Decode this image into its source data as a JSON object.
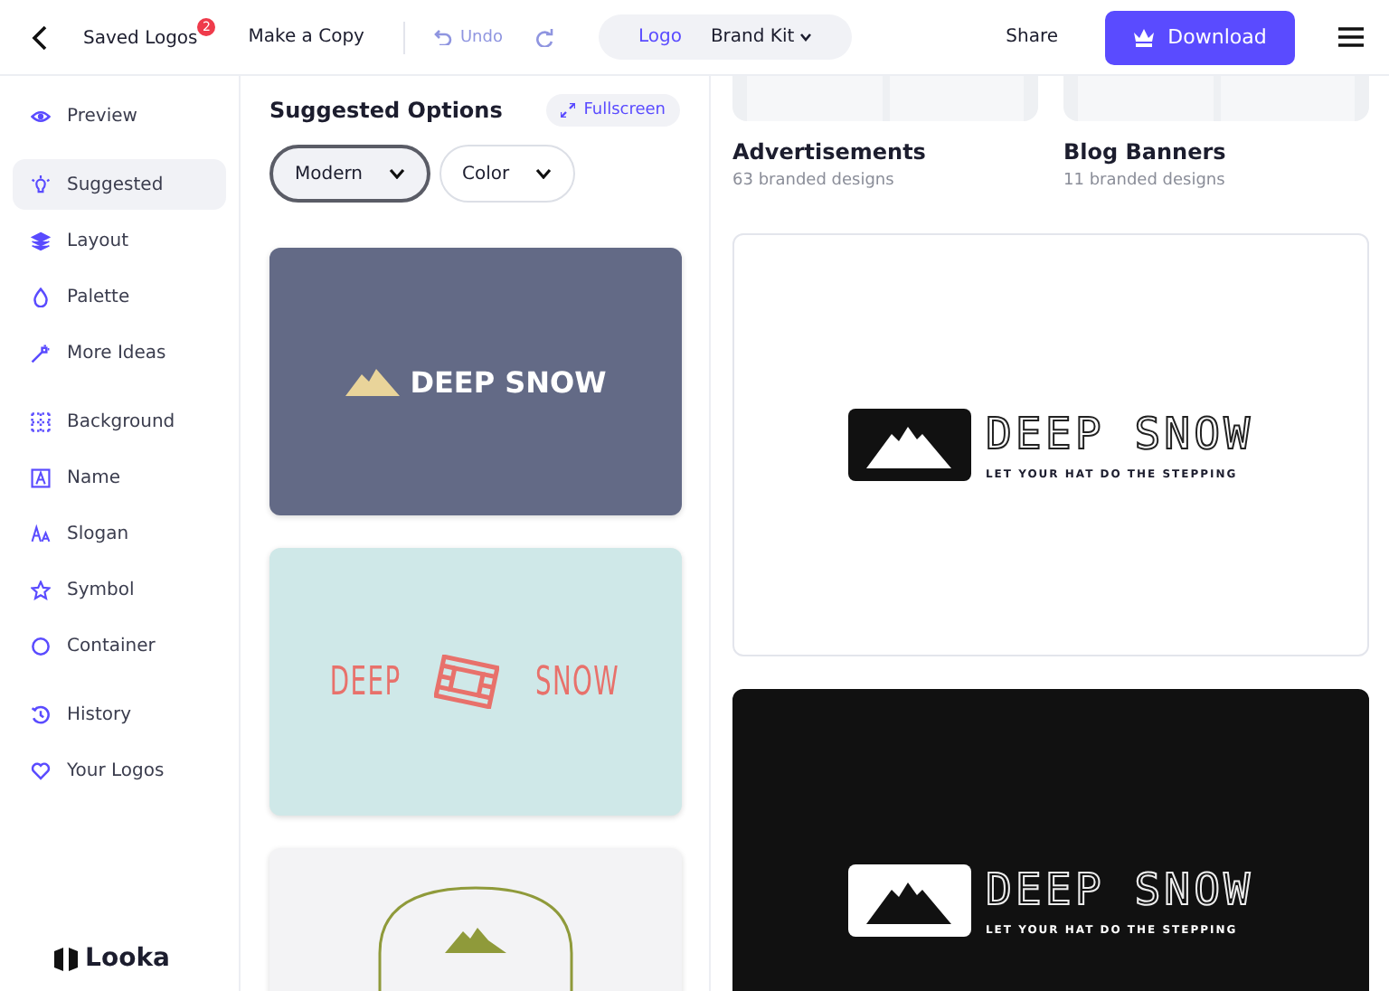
{
  "header": {
    "saved_logos": {
      "label": "Saved Logos",
      "badge": "2"
    },
    "make_copy": "Make a Copy",
    "undo": {
      "label": "Undo",
      "disabled": true
    },
    "redo": {
      "disabled": true
    },
    "tabs": [
      {
        "label": "Logo",
        "selected": true
      },
      {
        "label": "Brand Kit",
        "selected": false
      }
    ],
    "share": "Share",
    "download": "Download"
  },
  "sidebar": {
    "groups": [
      [
        {
          "label": "Preview",
          "kind": "eye",
          "selected": false
        }
      ],
      [
        {
          "label": "Suggested",
          "kind": "bulb",
          "selected": true
        },
        {
          "label": "Layout",
          "kind": "layers",
          "selected": false
        },
        {
          "label": "Palette",
          "kind": "drop",
          "selected": false
        },
        {
          "label": "More Ideas",
          "kind": "wand",
          "selected": false
        }
      ],
      [
        {
          "label": "Background",
          "kind": "grid",
          "selected": false
        },
        {
          "label": "Name",
          "kind": "letter",
          "selected": false
        },
        {
          "label": "Slogan",
          "kind": "font",
          "selected": false
        },
        {
          "label": "Symbol",
          "kind": "star",
          "selected": false
        },
        {
          "label": "Container",
          "kind": "circle",
          "selected": false
        }
      ],
      [
        {
          "label": "History",
          "kind": "history",
          "selected": false
        },
        {
          "label": "Your Logos",
          "kind": "heart",
          "selected": false
        }
      ]
    ],
    "brand": "Looka"
  },
  "suggested": {
    "title": "Suggested Options",
    "fullscreen": "Fullscreen",
    "filters": [
      {
        "label": "Modern",
        "selected": true
      },
      {
        "label": "Color",
        "selected": false
      }
    ],
    "options": [
      {
        "kind": "mountain",
        "name": "DEEP SNOW"
      },
      {
        "kind": "film",
        "words": [
          "DEEP",
          "SNOW"
        ]
      },
      {
        "kind": "badge"
      }
    ]
  },
  "categories": [
    {
      "title": "Advertisements",
      "subtitle": "63 branded designs"
    },
    {
      "title": "Blog Banners",
      "subtitle": "11 branded designs"
    }
  ],
  "previews": [
    {
      "kind": "light",
      "name": "DEEP SNOW",
      "slogan": "LET YOUR HAT DO THE STEPPING"
    },
    {
      "kind": "dark",
      "name": "DEEP SNOW",
      "slogan": "LET YOUR HAT DO THE STEPPING"
    }
  ]
}
